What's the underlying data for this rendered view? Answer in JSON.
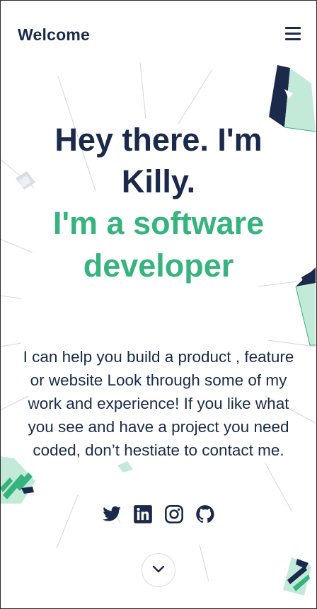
{
  "header": {
    "brand": "Welcome",
    "menu_icon": "hamburger-menu-icon"
  },
  "hero": {
    "title": "Hey there. I'm Killy.",
    "subtitle": "I'm a software developer",
    "description": "I can help you build a product , feature or website Look through some of my work and experience! If you like what you see and have a project you need coded, don’t hestiate to contact me."
  },
  "socials": [
    {
      "name": "twitter",
      "icon": "twitter-icon"
    },
    {
      "name": "linkedin",
      "icon": "linkedin-icon"
    },
    {
      "name": "instagram",
      "icon": "instagram-icon"
    },
    {
      "name": "github",
      "icon": "github-icon"
    }
  ],
  "scroll": {
    "icon": "chevron-down-icon"
  },
  "colors": {
    "navy": "#1b2a4a",
    "green": "#36b37e",
    "mint": "#c3ead9"
  }
}
